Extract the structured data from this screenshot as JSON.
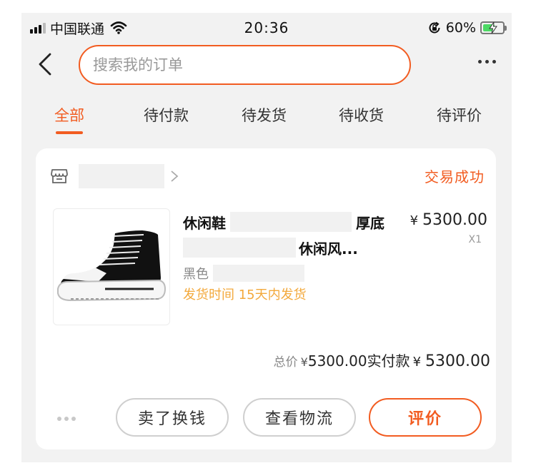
{
  "status_bar": {
    "carrier": "中国联通",
    "time": "20:36",
    "battery": "60%",
    "battery_level": 0.6
  },
  "header": {
    "search_placeholder": "搜索我的订单"
  },
  "tabs": [
    {
      "label": "全部",
      "active": true
    },
    {
      "label": "待付款",
      "active": false
    },
    {
      "label": "待发货",
      "active": false
    },
    {
      "label": "待收货",
      "active": false
    },
    {
      "label": "待评价",
      "active": false
    }
  ],
  "order": {
    "status": "交易成功",
    "product": {
      "title_start": "休闲鞋",
      "title_mid": "厚底",
      "title_end": "休闲风...",
      "variant_label": "黑色",
      "ship_note": "发货时间 15天内发货",
      "price_currency": "¥",
      "price": "5300.00",
      "quantity": "X1"
    },
    "totals": {
      "total_label": "总价",
      "total_currency": "¥",
      "total_value": "5300.00",
      "paid_label": "实付款",
      "paid_currency": "¥",
      "paid_value": "5300.00"
    },
    "actions": {
      "sell": "卖了换钱",
      "logistics": "查看物流",
      "review": "评价"
    }
  },
  "colors": {
    "accent": "#f25c21",
    "ship_note": "#f3a93c",
    "background": "#f2f2f2",
    "card": "#ffffff"
  }
}
